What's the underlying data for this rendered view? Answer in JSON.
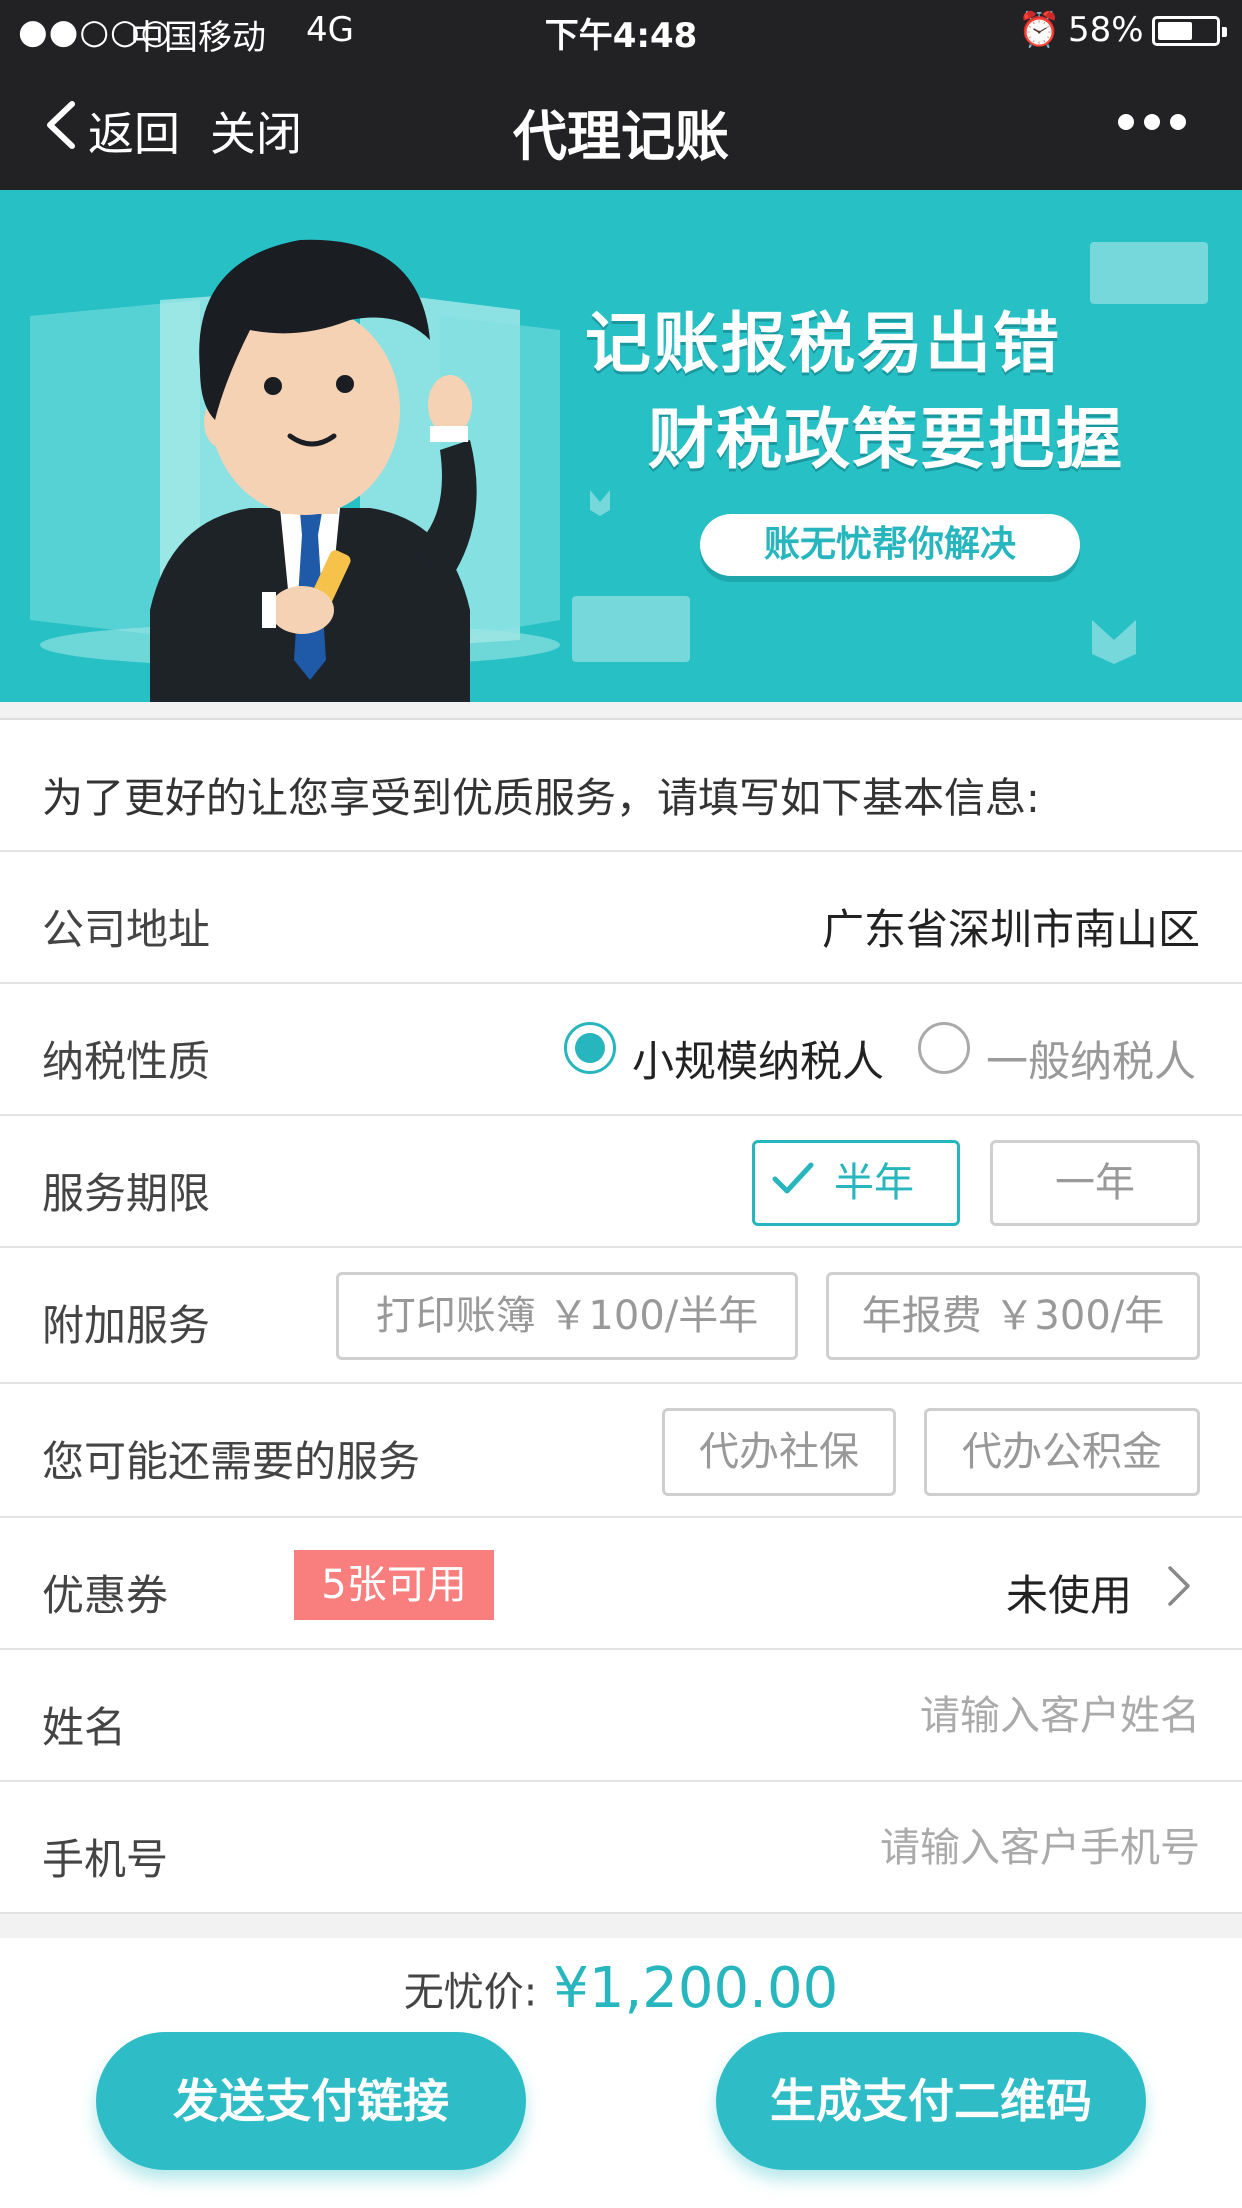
{
  "status_bar": {
    "signal": "●●○○○",
    "carrier": "中国移动",
    "network": "4G",
    "time": "下午4:48",
    "alarm_icon": "⏰",
    "battery": "58%"
  },
  "nav": {
    "back_label": "返回",
    "close_label": "关闭",
    "title": "代理记账"
  },
  "banner": {
    "line1": "记账报税易出错",
    "line2": "财税政策要把握",
    "pill": "账无忧帮你解决"
  },
  "form": {
    "intro": "为了更好的让您享受到优质服务，请填写如下基本信息:",
    "address": {
      "label": "公司地址",
      "value": "广东省深圳市南山区"
    },
    "tax": {
      "label": "纳税性质",
      "option_small": "小规模纳税人",
      "option_general": "一般纳税人",
      "selected": "小规模纳税人"
    },
    "period": {
      "label": "服务期限",
      "half_year": "半年",
      "one_year": "一年",
      "selected": "半年"
    },
    "extra": {
      "label": "附加服务",
      "print_books": "打印账簿 ￥100/半年",
      "annual_fee": "年报费 ￥300/年"
    },
    "maybe": {
      "label": "您可能还需要的服务",
      "social_security": "代办社保",
      "housing_fund": "代办公积金"
    },
    "coupon": {
      "label": "优惠券",
      "badge": "5张可用",
      "value": "未使用"
    },
    "name": {
      "label": "姓名",
      "placeholder": "请输入客户姓名"
    },
    "phone": {
      "label": "手机号",
      "placeholder": "请输入客户手机号"
    }
  },
  "footer": {
    "price_label": "无忧价:",
    "price_value": "¥1,200.00",
    "send_link_button": "发送支付链接",
    "qr_button": "生成支付二维码"
  },
  "colors": {
    "accent": "#27b6bd",
    "banner_bg": "#27c0c5",
    "nav_bg": "#222225",
    "coupon_badge": "#f97e7e"
  }
}
